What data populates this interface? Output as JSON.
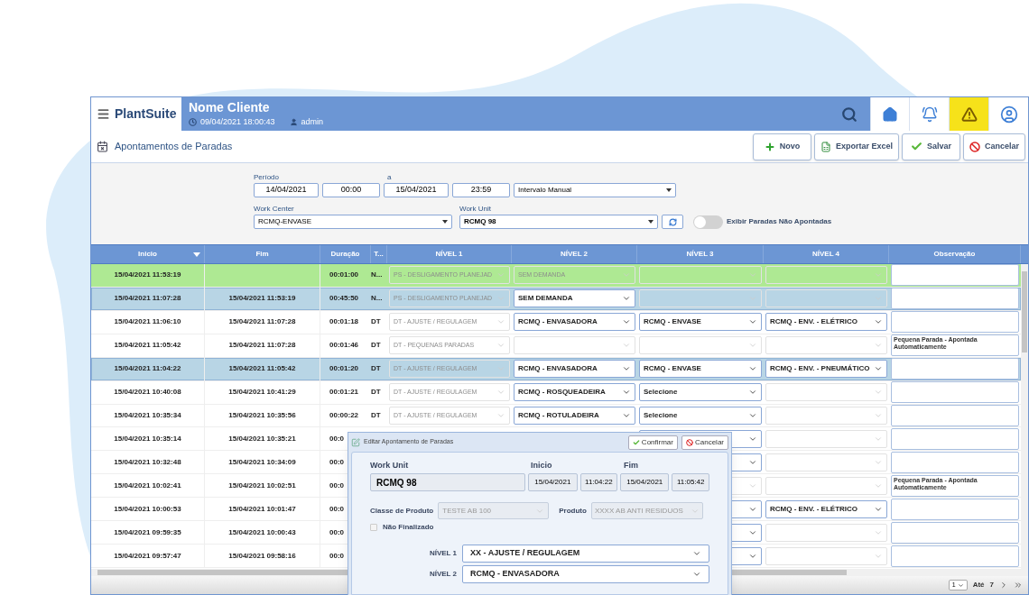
{
  "header": {
    "logo": "PlantSuite",
    "client": "Nome Cliente",
    "datetime": "09/04/2021 18:00:43",
    "user": "admin",
    "alert_active": true
  },
  "page": {
    "title": "Apontamentos de Paradas",
    "actions": [
      {
        "kind": "new",
        "label": "Novo"
      },
      {
        "kind": "excel",
        "label": "Exportar Excel"
      },
      {
        "kind": "save",
        "label": "Salvar"
      },
      {
        "kind": "cancel",
        "label": "Cancelar"
      }
    ]
  },
  "filters": {
    "period_label": "Período",
    "to_label": "a",
    "start_date": "14/04/2021",
    "start_time": "00:00",
    "end_date": "15/04/2021",
    "end_time": "23:59",
    "interval": "Intervalo Manual",
    "work_center_label": "Work Center",
    "work_center": "RCMQ-ENVASE",
    "work_unit_label": "Work Unit",
    "work_unit": "RCMQ 98",
    "toggle_label": "Exibir Paradas Não Apontadas",
    "toggle_on": false
  },
  "table": {
    "columns": [
      "Inicio",
      "Fim",
      "Duração",
      "T...",
      "NÍVEL 1",
      "NÍVEL 2",
      "NÍVEL 3",
      "NÍVEL 4",
      "Observação"
    ],
    "rows": [
      {
        "inicio": "15/04/2021 11:53:19",
        "duracao": "00:01:00",
        "tipo": "N...",
        "nivel1": {
          "text": "PS - DESLIGAMENTO PLANEJAD",
          "enabled": false
        },
        "nivel2": {
          "text": "SEM DEMANDA",
          "enabled": false
        },
        "nivel3": {
          "enabled": false
        },
        "nivel4": {
          "enabled": false
        },
        "running": true,
        "selected": false
      },
      {
        "inicio": "15/04/2021 11:07:28",
        "fim": "15/04/2021 11:53:19",
        "duracao": "00:45:50",
        "tipo": "N...",
        "nivel1": {
          "text": "PS - DESLIGAMENTO PLANEJAD",
          "enabled": false
        },
        "nivel2": {
          "text": "SEM DEMANDA",
          "enabled": true
        },
        "nivel3": {
          "enabled": false
        },
        "nivel4": {
          "enabled": false
        },
        "running": false,
        "selected": true
      },
      {
        "inicio": "15/04/2021 11:06:10",
        "fim": "15/04/2021 11:07:28",
        "duracao": "00:01:18",
        "tipo": "DT",
        "nivel1": {
          "text": "DT - AJUSTE / REGULAGEM",
          "enabled": false
        },
        "nivel2": {
          "text": "RCMQ - ENVASADORA",
          "enabled": true
        },
        "nivel3": {
          "text": "RCMQ - ENVASE",
          "enabled": true
        },
        "nivel4": {
          "text": "RCMQ - ENV. - ELÉTRICO",
          "enabled": true
        },
        "running": false,
        "selected": false
      },
      {
        "inicio": "15/04/2021 11:05:42",
        "fim": "15/04/2021 11:07:28",
        "duracao": "00:01:46",
        "tipo": "DT",
        "nivel1": {
          "text": "DT - PEQUENAS PARADAS",
          "enabled": false
        },
        "nivel2": {
          "enabled": false
        },
        "nivel3": {
          "enabled": false
        },
        "nivel4": {
          "enabled": false
        },
        "observacao": "Pequena Parada - Apontada Automaticamente",
        "running": false,
        "selected": false
      },
      {
        "inicio": "15/04/2021 11:04:22",
        "fim": "15/04/2021 11:05:42",
        "duracao": "00:01:20",
        "tipo": "DT",
        "nivel1": {
          "text": "DT - AJUSTE / REGULAGEM",
          "enabled": false
        },
        "nivel2": {
          "text": "RCMQ - ENVASADORA",
          "enabled": true
        },
        "nivel3": {
          "text": "RCMQ - ENVASE",
          "enabled": true
        },
        "nivel4": {
          "text": "RCMQ - ENV. - PNEUMÁTICO",
          "enabled": true
        },
        "running": false,
        "selected": true
      },
      {
        "inicio": "15/04/2021 10:40:08",
        "fim": "15/04/2021 10:41:29",
        "duracao": "00:01:21",
        "tipo": "DT",
        "nivel1": {
          "text": "DT - AJUSTE / REGULAGEM",
          "enabled": false
        },
        "nivel2": {
          "text": "RCMQ - ROSQUEADEIRA",
          "enabled": true
        },
        "nivel3": {
          "text": "Selecione",
          "enabled": true
        },
        "nivel4": {
          "enabled": false
        },
        "running": false,
        "selected": false
      },
      {
        "inicio": "15/04/2021 10:35:34",
        "fim": "15/04/2021 10:35:56",
        "duracao": "00:00:22",
        "tipo": "DT",
        "nivel1": {
          "text": "DT - AJUSTE / REGULAGEM",
          "enabled": false
        },
        "nivel2": {
          "text": "RCMQ - ROTULADEIRA",
          "enabled": true
        },
        "nivel3": {
          "text": "Selecione",
          "enabled": true
        },
        "nivel4": {
          "enabled": false
        },
        "running": false,
        "selected": false
      },
      {
        "inicio": "15/04/2021 10:35:14",
        "fim": "15/04/2021 10:35:21",
        "duracao": "00:0",
        "nivel3": {
          "enabled": true
        },
        "nivel4": {
          "enabled": false
        },
        "running": false,
        "selected": false
      },
      {
        "inicio": "15/04/2021 10:32:48",
        "fim": "15/04/2021 10:34:09",
        "duracao": "00:0",
        "nivel3": {
          "enabled": true
        },
        "nivel4": {
          "enabled": false
        },
        "running": false,
        "selected": false
      },
      {
        "inicio": "15/04/2021 10:02:41",
        "fim": "15/04/2021 10:02:51",
        "duracao": "00:0",
        "nivel3": {
          "enabled": false
        },
        "nivel4": {
          "enabled": false
        },
        "observacao": "Pequena Parada - Apontada Automaticamente",
        "running": false,
        "selected": false
      },
      {
        "inicio": "15/04/2021 10:00:53",
        "fim": "15/04/2021 10:01:47",
        "duracao": "00:0",
        "nivel3": {
          "enabled": true
        },
        "nivel4": {
          "text": "RCMQ - ENV. - ELÉTRICO",
          "enabled": true
        },
        "running": false,
        "selected": false
      },
      {
        "inicio": "15/04/2021 09:59:35",
        "fim": "15/04/2021 10:00:43",
        "duracao": "00:0",
        "nivel3": {
          "enabled": true
        },
        "nivel4": {
          "enabled": false
        },
        "running": false,
        "selected": false
      },
      {
        "inicio": "15/04/2021 09:57:47",
        "fim": "15/04/2021 09:58:16",
        "duracao": "00:0",
        "nivel3": {
          "enabled": true
        },
        "nivel4": {
          "enabled": false
        },
        "running": false,
        "selected": false
      }
    ]
  },
  "pager": {
    "page": "1",
    "until_label": "Até",
    "total": "7"
  },
  "dialog": {
    "title": "Editar Apontamento de Paradas",
    "confirm": "Confirmar",
    "cancel": "Cancelar",
    "work_unit_label": "Work Unit",
    "work_unit": "RCMQ 98",
    "start_label": "Inicio",
    "start_date": "15/04/2021",
    "start_time": "11:04:22",
    "end_label": "Fim",
    "end_date": "15/04/2021",
    "end_time": "11:05:42",
    "class_label": "Classe de Produto",
    "class": "TESTE AB 100",
    "product_label": "Produto",
    "product": "XXXX AB ANTI RESIDUOS",
    "unfinished_label": "Não Finalizado",
    "unfinished": false,
    "levels": [
      {
        "label": "NÍVEL 1",
        "value": "XX - AJUSTE / REGULAGEM"
      },
      {
        "label": "NÍVEL 2",
        "value": "RCMQ - ENVASADORA"
      }
    ]
  }
}
